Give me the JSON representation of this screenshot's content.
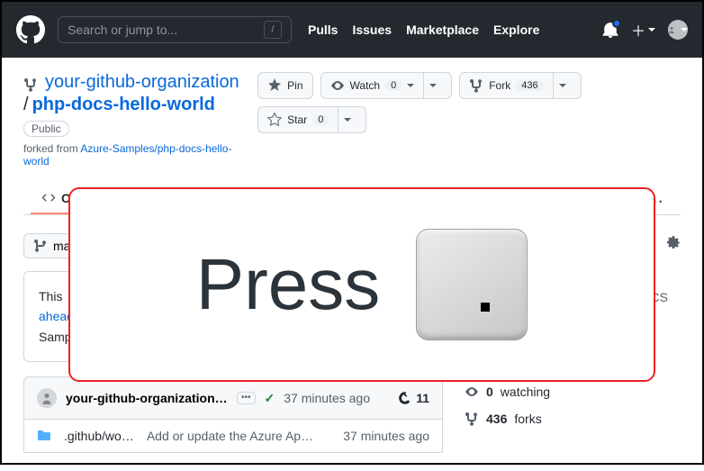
{
  "header": {
    "search_placeholder": "Search or jump to...",
    "slash": "/",
    "nav": {
      "pulls": "Pulls",
      "issues": "Issues",
      "marketplace": "Marketplace",
      "explore": "Explore"
    }
  },
  "repo": {
    "owner": "your-github-organization",
    "name": "php-docs-hello-world",
    "visibility": "Public",
    "forked_prefix": "forked from ",
    "forked_from": "Azure-Samples/php-docs-hello-world"
  },
  "actions": {
    "pin": "Pin",
    "watch": "Watch",
    "watch_count": "0",
    "fork": "Fork",
    "fork_count": "436",
    "star": "Star",
    "star_count": "0"
  },
  "tabs": {
    "code": "Code",
    "kebab": "..."
  },
  "branch": {
    "label": "main"
  },
  "infobox": {
    "line1": "This",
    "ahead": "ahead",
    "line3": "Samples"
  },
  "commit": {
    "author": "your-github-organization A…",
    "ellipsis": "•••",
    "check": "✓",
    "time": "37 minutes ago",
    "history_count": "11"
  },
  "file": {
    "name": ".github/wo…",
    "msg": "Add or update the Azure Ap…",
    "time": "37 minutes ago"
  },
  "sidebar": {
    "watching_count": "0",
    "watching_label": "watching",
    "forks_count": "436",
    "forks_label": "forks",
    "cs": "CS"
  },
  "overlay": {
    "text": "Press"
  }
}
